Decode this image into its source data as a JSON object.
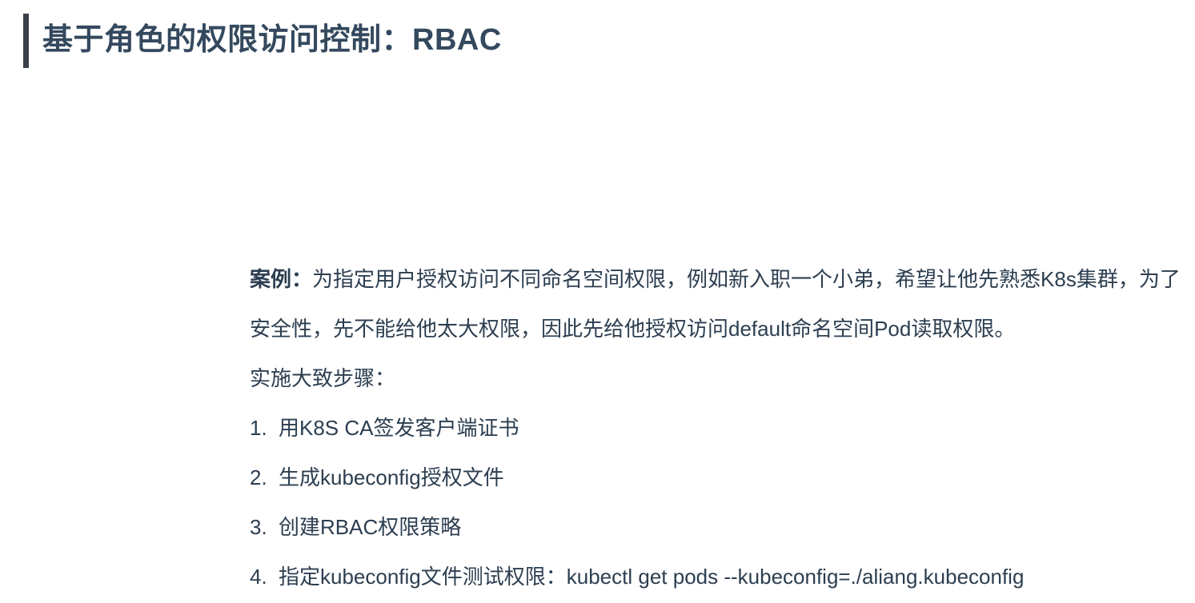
{
  "title": "基于角色的权限访问控制：RBAC",
  "case": {
    "label": "案例：",
    "line1": "为指定用户授权访问不同命名空间权限，例如新入职一个小弟，希望让他先熟悉K8s集群，为了",
    "line2": "安全性，先不能给他太大权限，因此先给他授权访问default命名空间Pod读取权限。"
  },
  "steps_intro": "实施大致步骤：",
  "steps": [
    {
      "num": "1.",
      "text": "用K8S CA签发客户端证书"
    },
    {
      "num": "2.",
      "text": "生成kubeconfig授权文件"
    },
    {
      "num": "3.",
      "text": "创建RBAC权限策略"
    },
    {
      "num": "4.",
      "text": "指定kubeconfig文件测试权限：kubectl get pods --kubeconfig=./aliang.kubeconfig"
    }
  ],
  "colors": {
    "title_text": "#34495e",
    "title_bar": "#3a3f47",
    "body_text": "#2c3e50"
  }
}
